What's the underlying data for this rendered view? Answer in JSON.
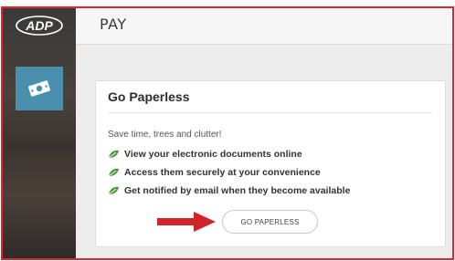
{
  "app": {
    "logo_text": "ADP"
  },
  "sidebar": {
    "items": [
      {
        "icon": "money-icon",
        "active": true
      }
    ]
  },
  "header": {
    "title": "PAY"
  },
  "card": {
    "title": "Go Paperless",
    "intro": "Save time, trees and clutter!",
    "benefits": [
      "View your electronic documents online",
      "Access them securely at your convenience",
      "Get notified by email when they become available"
    ],
    "button_label": "GO PAPERLESS"
  },
  "colors": {
    "highlight_border": "#e0262b",
    "pay_tile": "#4a8fae",
    "leaf": "#4a9a3a",
    "arrow": "#d0232a"
  }
}
